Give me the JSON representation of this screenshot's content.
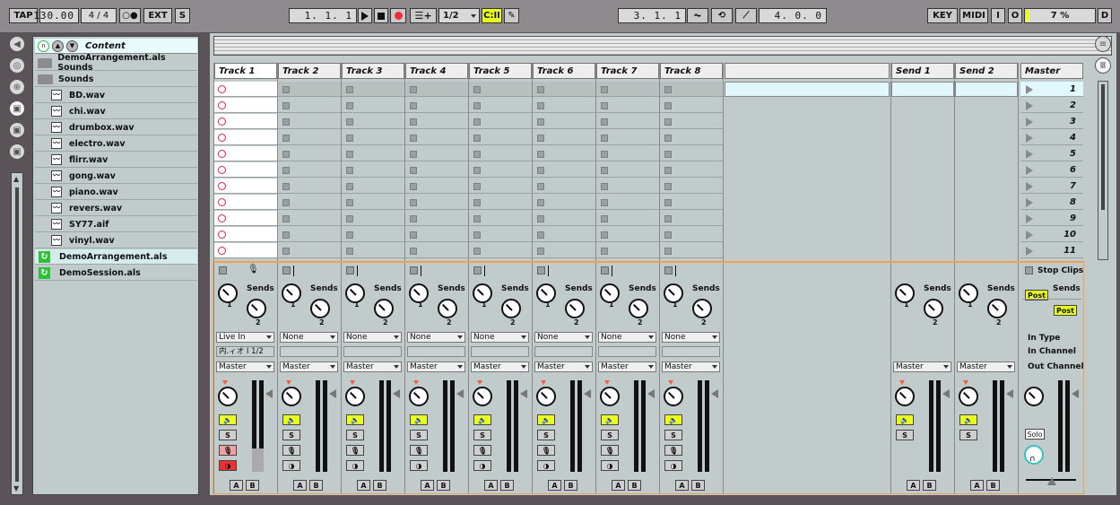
{
  "transport": {
    "tap": "TAP",
    "tempo": "130.00",
    "signature": "4 / 4",
    "metronome": "○●",
    "ext": "EXT",
    "s": "S",
    "position": "1.  1.  1",
    "quantize": "1/2",
    "follow": "C:II",
    "loop_start": "3.  1.  1",
    "loop_length": "4.  0.  0",
    "key": "KEY",
    "midi": "MIDI",
    "i": "I",
    "o": "O",
    "cpu": "7 %",
    "d": "D"
  },
  "browser": {
    "header": "Content",
    "items": [
      {
        "type": "folder",
        "label": "DemoArrangement.als Sounds"
      },
      {
        "type": "folder",
        "label": "Sounds"
      },
      {
        "type": "wav",
        "label": "BD.wav"
      },
      {
        "type": "wav",
        "label": "chi.wav"
      },
      {
        "type": "wav",
        "label": "drumbox.wav"
      },
      {
        "type": "wav",
        "label": "electro.wav"
      },
      {
        "type": "wav",
        "label": "flirr.wav"
      },
      {
        "type": "wav",
        "label": "gong.wav"
      },
      {
        "type": "wav",
        "label": "piano.wav"
      },
      {
        "type": "wav",
        "label": "revers.wav"
      },
      {
        "type": "wav",
        "label": "SY77.aif"
      },
      {
        "type": "wav",
        "label": "vinyl.wav"
      },
      {
        "type": "als",
        "label": "DemoArrangement.als"
      },
      {
        "type": "als",
        "label": "DemoSession.als"
      }
    ]
  },
  "tracks": [
    {
      "name": "Track 1",
      "input_type": "Live In",
      "input_channel": "内.ィオ I 1/2",
      "output": "Master"
    },
    {
      "name": "Track 2",
      "input_type": "None",
      "input_channel": "",
      "output": "Master"
    },
    {
      "name": "Track 3",
      "input_type": "None",
      "input_channel": "",
      "output": "Master"
    },
    {
      "name": "Track 4",
      "input_type": "None",
      "input_channel": "",
      "output": "Master"
    },
    {
      "name": "Track 5",
      "input_type": "None",
      "input_channel": "",
      "output": "Master"
    },
    {
      "name": "Track 6",
      "input_type": "None",
      "input_channel": "",
      "output": "Master"
    },
    {
      "name": "Track 7",
      "input_type": "None",
      "input_channel": "",
      "output": "Master"
    },
    {
      "name": "Track 8",
      "input_type": "None",
      "input_channel": "",
      "output": "Master"
    }
  ],
  "returns": [
    {
      "name": "Send 1",
      "output": "Master"
    },
    {
      "name": "Send 2",
      "output": "Master"
    }
  ],
  "master": {
    "name": "Master",
    "stop_clips": "Stop Clips",
    "post_1": "Post",
    "post_2": "Post",
    "sends": "Sends",
    "in_type": "In Type",
    "in_channel": "In Channel",
    "out_channel": "Out Channel",
    "solo": "Solo"
  },
  "scenes": [
    "1",
    "2",
    "3",
    "4",
    "5",
    "6",
    "7",
    "8",
    "9",
    "10",
    "11"
  ],
  "labels": {
    "sends": "Sends",
    "knob_a": "1",
    "knob_b": "2",
    "s": "S",
    "a": "A",
    "b": "B"
  },
  "colors": {
    "accent_yellow": "#e9ff1f",
    "record_red": "#e0234e",
    "selection_cyan": "#e0f8fb",
    "focus_orange": "#f0a050"
  }
}
